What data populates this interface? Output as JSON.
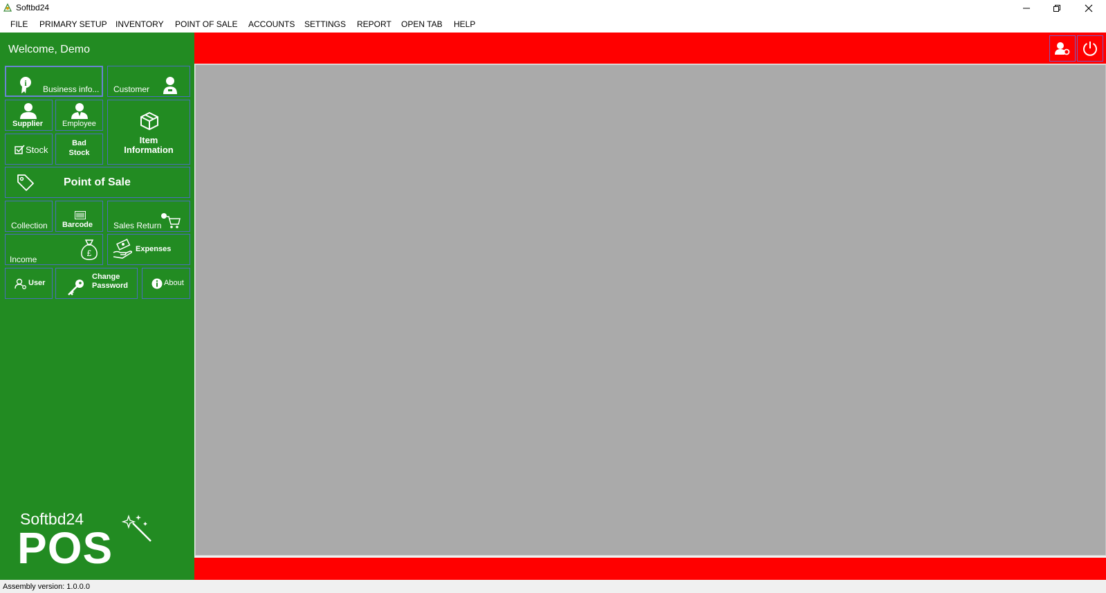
{
  "window": {
    "title": "Softbd24",
    "minimize_icon": "minimize-icon",
    "restore_icon": "restore-icon",
    "close_icon": "close-icon"
  },
  "menu": [
    "FILE",
    "PRIMARY SETUP",
    "INVENTORY",
    "POINT OF SALE",
    "ACCOUNTS",
    "SETTINGS",
    "REPORT",
    "OPEN TAB",
    "HELP"
  ],
  "sidebar": {
    "welcome": "Welcome, Demo",
    "tiles": {
      "business_info": "Business info...",
      "customer": "Customer",
      "supplier": "Supplier",
      "employee": "Employee",
      "item_info_1": "Item",
      "item_info_2": "Information",
      "stock": "Stock",
      "bad_stock_1": "Bad",
      "bad_stock_2": "Stock",
      "point_of_sale": "Point of Sale",
      "collection": "Collection",
      "barcode": "Barcode",
      "sales_return": "Sales Return",
      "income": "Income",
      "expenses": "Expenses",
      "user": "User",
      "change_password_1": "Change",
      "change_password_2": "Password",
      "about": "About"
    },
    "brand_name": "Softbd24",
    "brand_product": "POS"
  },
  "header": {
    "user_settings_icon": "user-settings-icon",
    "power_icon": "power-icon"
  },
  "colors": {
    "sidebar": "#228b22",
    "header_bar": "#ff0000",
    "content_bg": "#aaaaaa",
    "tile_border": "#4a6fbd"
  },
  "status": {
    "assembly": "Assembly version: 1.0.0.0"
  }
}
